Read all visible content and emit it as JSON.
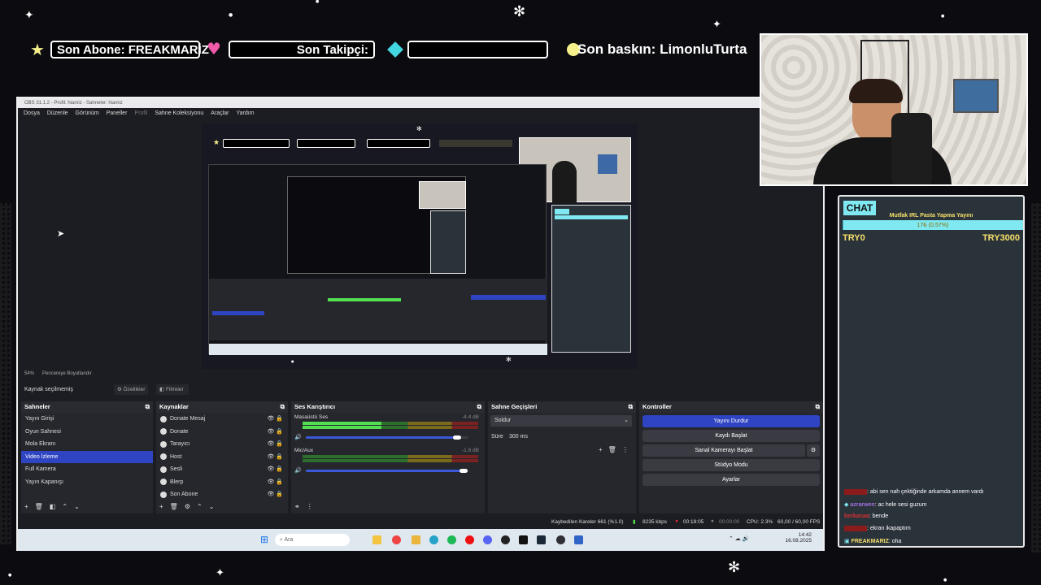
{
  "overlay": {
    "last_sub_label": "Son Abone: FREAKMARİZ",
    "last_follow_label": "Son Takipçi:",
    "last_raid_label": "Son baskın: LimonluTurta"
  },
  "obs": {
    "window_title": "OBS 31.1.2 - Profil: hiamiz - Sahneler: hiamiz",
    "menu": [
      "Dosya",
      "Düzenle",
      "Görünüm",
      "Paneller",
      "Profil",
      "Sahne Koleksiyonu",
      "Araçlar",
      "Yardım"
    ],
    "zoom_label": "54%",
    "fit_label": "Pencereye Boyutlandır",
    "no_source": "Kaynak seçilmemiş",
    "properties_btn": "Özellikler",
    "filters_btn": "Filtreler",
    "scenes": {
      "title": "Sahneler",
      "items": [
        "Yayın Girişi",
        "Oyun Sahnesi",
        "Mola Ekranı",
        "Video İzleme",
        "Full Kamera",
        "Yayın Kapanışı"
      ],
      "selected_index": 3
    },
    "sources": {
      "title": "Kaynaklar",
      "items": [
        "Donate Mesaj",
        "Donate",
        "Tarayıcı",
        "Host",
        "Sesli",
        "Blerp",
        "Son Abone"
      ]
    },
    "mixer": {
      "title": "Ses Karıştırıcı",
      "channels": [
        {
          "name": "Masaüstü Ses",
          "db": "-4.4 dB",
          "level": 0.45,
          "volume": 0.93
        },
        {
          "name": "Mic/Aux",
          "db": "-1.6 dB",
          "level": 0.0,
          "volume": 0.97
        }
      ],
      "ticks": [
        "-60",
        "-55",
        "-50",
        "-45",
        "-40",
        "-35",
        "-30",
        "-25",
        "-20",
        "-15",
        "-10",
        "-5",
        "0"
      ]
    },
    "transitions": {
      "title": "Sahne Geçişleri",
      "selected": "Soldur",
      "duration_label": "Süre",
      "duration_value": "300 ms"
    },
    "controls": {
      "title": "Kontroller",
      "stop_stream": "Yayını Durdur",
      "start_record": "Kaydı Başlat",
      "virtual_cam": "Sanal Kamerayı Başlat",
      "studio_mode": "Stüdyo Modu",
      "settings": "Ayarlar"
    },
    "status": {
      "dropped": "Kaybedilen Kareler 661 (%1.0)",
      "bitrate": "8235 kbps",
      "live_time": "00:18:05",
      "rec_time": "00:00:00",
      "cpu": "CPU: 2.3%",
      "fps": "60,00 / 60,00 FPS"
    },
    "taskbar": {
      "search_placeholder": "Ara",
      "time": "14:42",
      "date": "16.08.2025"
    }
  },
  "chat": {
    "header": "CHAT",
    "goal_title": "Mutfak IRL Pasta Yapma Yayını",
    "goal_progress": "17₺ (0.57%)",
    "goal_fraction": 0.0057,
    "goal_min": "TRY0",
    "goal_max": "TRY3000",
    "messages": [
      {
        "user": "",
        "text": ": abi sen nah çektiğinde arkamda annem vardı",
        "color": "red"
      },
      {
        "user": "azrarwen",
        "text": ": ac hele sesi guzum",
        "color": "purple"
      },
      {
        "user": "berkanaa",
        "text": ": bende",
        "color": "red"
      },
      {
        "user": "",
        "text": ": ekran ikapaptım",
        "color": "red"
      },
      {
        "user": "FREAKMARIZ",
        "text": ": oha",
        "color": "yellow"
      }
    ]
  },
  "colors": {
    "accent_blue": "#2f44c2",
    "chat_bg": "#2a323a",
    "goal_cyan": "#7fe8f0",
    "heart_pink": "#f05aa8",
    "gem_cyan": "#42d6e0"
  }
}
